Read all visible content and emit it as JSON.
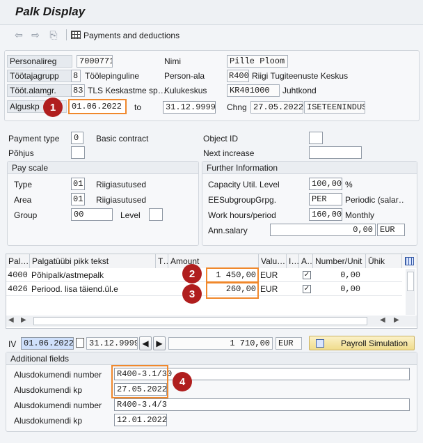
{
  "window": {
    "title": "Palk Display"
  },
  "toolbar": {
    "payments_label": "Payments and deductions"
  },
  "header": {
    "personalireg_label": "Personalireg",
    "personalireg_value": "7000771",
    "nimi_label": "Nimi",
    "nimi_value": "Pille Ploom",
    "tootajagrupp_label": "Töötajagrupp",
    "tootajagrupp_code": "8",
    "tootajagrupp_text": "Töölepinguline",
    "personala_label": "Person-ala",
    "personala_code": "R400",
    "personala_text": "Riigi Tugiteenuste Keskus",
    "tootalamgr_label": "Tööt.alamgr.",
    "tootalamgr_code": "83",
    "tootalamgr_text": "TLS Keskastme sp…",
    "kulukeskus_label": "Kulukeskus",
    "kulukeskus_code": "KR401000",
    "kulukeskus_text": "Juhtkond",
    "alguskp_label": "Alguskp",
    "alguskp_value": "01.06.2022",
    "to_label": "to",
    "to_value": "31.12.9999",
    "chng_label": "Chng",
    "chng_date": "27.05.2022",
    "chng_user": "ISETEENINDUS"
  },
  "basic": {
    "payment_type_label": "Payment type",
    "payment_type_value": "0",
    "payment_type_text": "Basic contract",
    "pohjus_label": "Põhjus",
    "pohjus_value": "",
    "object_id_label": "Object ID",
    "object_id_value": "",
    "next_increase_label": "Next increase",
    "next_increase_value": ""
  },
  "pay_scale": {
    "title": "Pay scale",
    "type_label": "Type",
    "type_code": "01",
    "type_text": "Riigiasutused",
    "area_label": "Area",
    "area_code": "01",
    "area_text": "Riigiasutused",
    "group_label": "Group",
    "group_value": "00",
    "level_label": "Level",
    "level_value": ""
  },
  "further": {
    "title": "Further Information",
    "capacity_label": "Capacity Util. Level",
    "capacity_value": "100,00",
    "capacity_unit": "%",
    "eesub_label": "EESubgroupGrpg.",
    "eesub_value": "PER",
    "eesub_text": "Periodic (salar…",
    "workhours_label": "Work hours/period",
    "workhours_value": "160,00",
    "workhours_unit": "Monthly",
    "annsalary_label": "Ann.salary",
    "annsalary_value": "0,00",
    "annsalary_currency": "EUR"
  },
  "table": {
    "columns": [
      "Pal…",
      "Palgatüübi pikk tekst",
      "T…",
      "Amount",
      "Valu…",
      "I…",
      "A…",
      "Number/Unit",
      "Ühik"
    ],
    "rows": [
      {
        "code": "4000",
        "text": "Põhipalk/astmepalk",
        "amount": "1 450,00",
        "currency": "EUR",
        "checked": true,
        "number": "0,00"
      },
      {
        "code": "4026",
        "text": "Periood. lisa täiend.ül.e",
        "amount": "260,00",
        "currency": "EUR",
        "checked": true,
        "number": "0,00"
      }
    ]
  },
  "summary": {
    "iv_label": "IV",
    "from_value": "01.06.2022",
    "to_value": "31.12.9999",
    "total": "1 710,00",
    "currency": "EUR",
    "payroll_button": "Payroll Simulation"
  },
  "additional": {
    "title": "Additional fields",
    "rows": [
      {
        "label": "Alusdokumendi number",
        "value": "R400-3.1/30"
      },
      {
        "label": "Alusdokumendi kp",
        "value": "27.05.2022"
      },
      {
        "label": "Alusdokumendi number",
        "value": "R400-3.4/3"
      },
      {
        "label": "Alusdokumendi kp",
        "value": "12.01.2022"
      }
    ]
  },
  "badges": [
    "1",
    "2",
    "3",
    "4"
  ],
  "colors": {
    "highlight": "#f0882c",
    "badge": "#b01e1e",
    "payroll_button": "#f5e6a8"
  }
}
